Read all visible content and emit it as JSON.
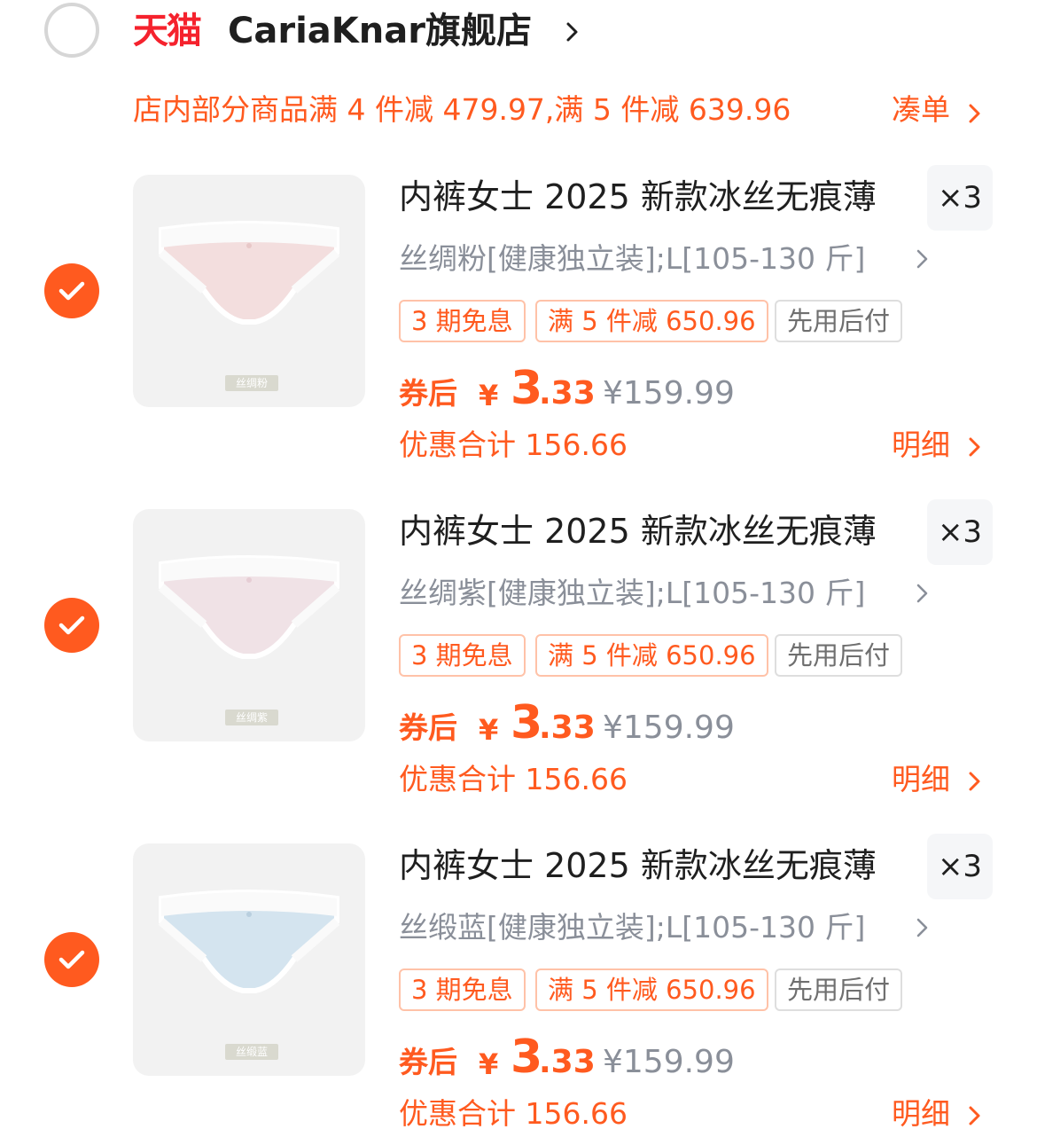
{
  "store": {
    "brand_badge": "天猫",
    "name": "CariaKnar旗舰店",
    "selected": false
  },
  "promo": {
    "text": "店内部分商品满 4 件减 479.97,满 5 件减 639.96",
    "link_label": "凑单"
  },
  "colors": {
    "accent": "#ff5a1f",
    "brand_red": "#f5222d",
    "muted_text": "#8a8f99"
  },
  "items": [
    {
      "selected": true,
      "thumb_label": "丝绸粉",
      "swatch": "#f3dede",
      "title": "内裤女士 2025 新款冰丝无痕薄",
      "qty": "×3",
      "sku": "丝绸粉[健康独立装];L[105-130 斤]",
      "tags": [
        "3 期免息",
        "满 5 件减 650.96",
        "先用后付"
      ],
      "after_label": "券后",
      "currency": "¥",
      "price_int": "3",
      "price_dec": ".33",
      "orig_price": "¥159.99",
      "discount": "优惠合计 156.66",
      "detail_label": "明细"
    },
    {
      "selected": true,
      "thumb_label": "丝绸紫",
      "swatch": "#f0e2e6",
      "title": "内裤女士 2025 新款冰丝无痕薄",
      "qty": "×3",
      "sku": "丝绸紫[健康独立装];L[105-130 斤]",
      "tags": [
        "3 期免息",
        "满 5 件减 650.96",
        "先用后付"
      ],
      "after_label": "券后",
      "currency": "¥",
      "price_int": "3",
      "price_dec": ".33",
      "orig_price": "¥159.99",
      "discount": "优惠合计 156.66",
      "detail_label": "明细"
    },
    {
      "selected": true,
      "thumb_label": "丝缎蓝",
      "swatch": "#d4e4ef",
      "title": "内裤女士 2025 新款冰丝无痕薄",
      "qty": "×3",
      "sku": "丝缎蓝[健康独立装];L[105-130 斤]",
      "tags": [
        "3 期免息",
        "满 5 件减 650.96",
        "先用后付"
      ],
      "after_label": "券后",
      "currency": "¥",
      "price_int": "3",
      "price_dec": ".33",
      "orig_price": "¥159.99",
      "discount": "优惠合计 156.66",
      "detail_label": "明细"
    }
  ]
}
